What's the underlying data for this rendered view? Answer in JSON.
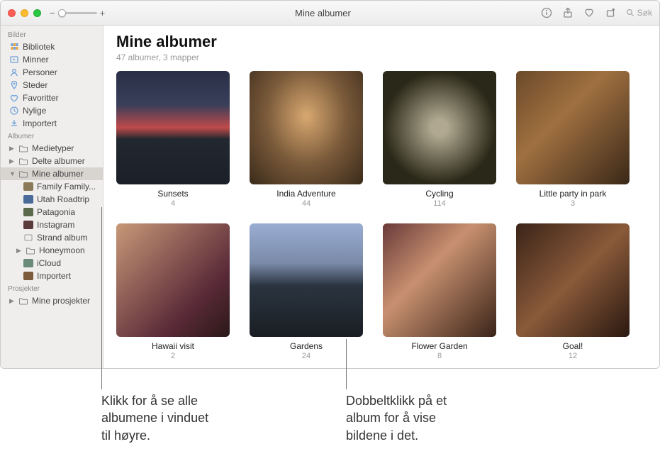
{
  "window_title": "Mine albumer",
  "toolbar": {
    "search_placeholder": "Søk"
  },
  "sidebar": {
    "sections": {
      "bilder": "Bilder",
      "albumer": "Albumer",
      "prosjekter": "Prosjekter"
    },
    "bilder_items": [
      {
        "label": "Bibliotek",
        "icon": "library"
      },
      {
        "label": "Minner",
        "icon": "memories"
      },
      {
        "label": "Personer",
        "icon": "people"
      },
      {
        "label": "Steder",
        "icon": "places"
      },
      {
        "label": "Favoritter",
        "icon": "favorites"
      },
      {
        "label": "Nylige",
        "icon": "recent"
      },
      {
        "label": "Importert",
        "icon": "imported"
      }
    ],
    "albumer_items": {
      "medietyper": "Medietyper",
      "delte": "Delte albumer",
      "mine": "Mine albumer",
      "children": [
        {
          "label": "Family Family..."
        },
        {
          "label": "Utah Roadtrip"
        },
        {
          "label": "Patagonia"
        },
        {
          "label": "Instagram"
        },
        {
          "label": "Strand album"
        },
        {
          "label": "Honeymoon"
        },
        {
          "label": "iCloud"
        },
        {
          "label": "Importert"
        }
      ]
    },
    "prosjekter_items": {
      "mine_prosjekter": "Mine prosjekter"
    }
  },
  "main": {
    "title": "Mine albumer",
    "subtitle": "47 albumer, 3 mapper",
    "albums": [
      {
        "name": "Sunsets",
        "count": "4",
        "thumb": "th-sunset"
      },
      {
        "name": "India Adventure",
        "count": "44",
        "thumb": "th-india"
      },
      {
        "name": "Cycling",
        "count": "114",
        "thumb": "th-cycling"
      },
      {
        "name": "Little party in park",
        "count": "3",
        "thumb": "th-party"
      },
      {
        "name": "Hawaii visit",
        "count": "2",
        "thumb": "th-hawaii"
      },
      {
        "name": "Gardens",
        "count": "24",
        "thumb": "th-gardens"
      },
      {
        "name": "Flower Garden",
        "count": "8",
        "thumb": "th-flower"
      },
      {
        "name": "Goal!",
        "count": "12",
        "thumb": "th-goal"
      }
    ]
  },
  "callouts": {
    "left": "Klikk for å se alle\nalbumene i vinduet\ntil høyre.",
    "right": "Dobbeltklikk på et\nalbum for å vise\nbildene i det."
  }
}
